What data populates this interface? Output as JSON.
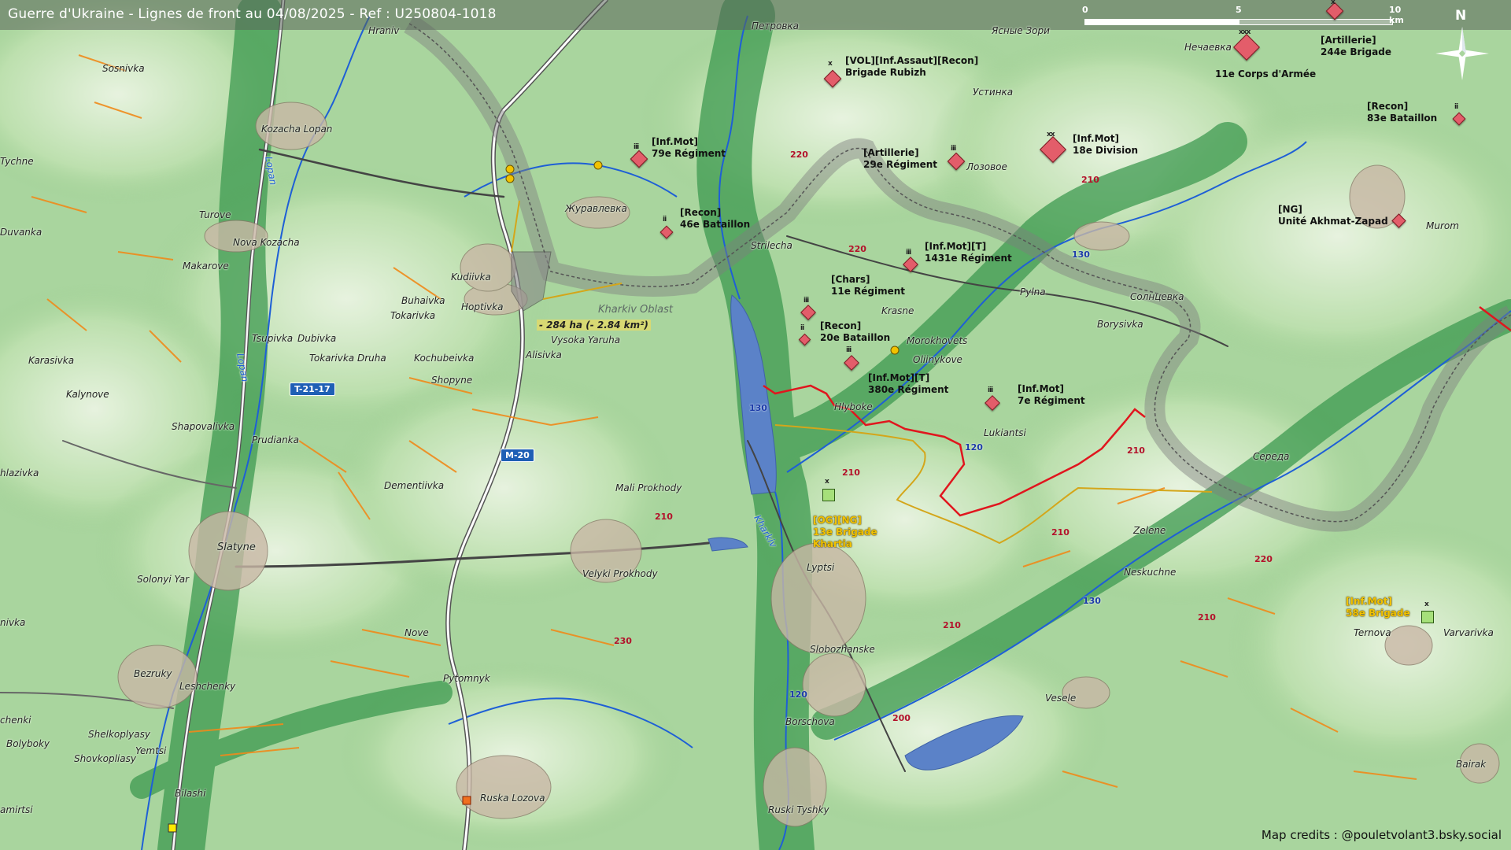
{
  "header": {
    "title": "Guerre d'Ukraine - Lignes de front au 04/08/2025 - Ref : U250804-1018"
  },
  "scale_bar": {
    "ticks": [
      "0",
      "5",
      "10 km"
    ]
  },
  "north_arrow": {
    "letter": "N",
    "icon": "compass-rose-icon"
  },
  "credits": "Map credits : @pouletvolant3.bsky.social",
  "colors": {
    "front_line": "#e0161e",
    "ukraine_line": "#d4a61a",
    "russia_marker": "#e35d6a",
    "ukraine_marker": "#a6e07a",
    "border": "#7a7a7a",
    "water": "#5b82c8"
  },
  "gain": {
    "label": "- 284 ha (- 2.84 km²)"
  },
  "oblast_label": "Kharkiv Oblast",
  "units": [
    {
      "side": "russia",
      "echelon": "x",
      "lines": [
        "[VOL][Inf.Assaut][Recon]",
        "Brigade Rubizh"
      ]
    },
    {
      "side": "russia",
      "echelon": "xx",
      "lines": [
        "[Inf.Mot]",
        "18e Division"
      ]
    },
    {
      "side": "russia",
      "echelon": "xxx",
      "lines": [
        "11e Corps d'Armée"
      ]
    },
    {
      "side": "russia",
      "echelon": "x",
      "lines": [
        "[Artillerie]",
        "244e Brigade"
      ]
    },
    {
      "side": "russia",
      "echelon": "ii",
      "lines": [
        "[Recon]",
        "83e Bataillon"
      ]
    },
    {
      "side": "russia",
      "echelon": "iii",
      "lines": [
        "[Inf.Mot]",
        "79e Régiment"
      ]
    },
    {
      "side": "russia",
      "echelon": "iii",
      "lines": [
        "[Artillerie]",
        "29e Régiment"
      ]
    },
    {
      "side": "russia",
      "echelon": "ii",
      "lines": [
        "[Recon]",
        "46e Bataillon"
      ]
    },
    {
      "side": "russia",
      "echelon": "",
      "lines": [
        "[NG]",
        "Unité Akhmat-Zapad"
      ]
    },
    {
      "side": "russia",
      "echelon": "iii",
      "lines": [
        "[Inf.Mot][T]",
        "1431e Régiment"
      ]
    },
    {
      "side": "russia",
      "echelon": "iii",
      "lines": [
        "[Chars]",
        "11e Régiment"
      ]
    },
    {
      "side": "russia",
      "echelon": "ii",
      "lines": [
        "[Recon]",
        "20e Bataillon"
      ]
    },
    {
      "side": "russia",
      "echelon": "iii",
      "lines": [
        "[Inf.Mot][T]",
        "380e Régiment"
      ]
    },
    {
      "side": "russia",
      "echelon": "iii",
      "lines": [
        "[Inf.Mot]",
        "7e Régiment"
      ]
    },
    {
      "side": "ukraine",
      "echelon": "x",
      "lines": [
        "[OG][NG]",
        "13e Brigade",
        "Khartia"
      ]
    },
    {
      "side": "ukraine",
      "echelon": "x",
      "lines": [
        "[Inf.Mot]",
        "58e Brigade"
      ]
    }
  ],
  "places": [
    "Hraniv",
    "Sosnivka",
    "Kozacha Lopan",
    "Petrovka",
    "Петровка",
    "Ясные Зори",
    "Нечаевка",
    "Устинка",
    "Лозовое",
    "Журавлевка",
    "Turove",
    "Nova Kozacha",
    "Makarove",
    "Kudiivka",
    "Hoptivka",
    "Buhaivka",
    "Tokarivka",
    "Vysoka Yaruha",
    "Alisivka",
    "Tsupivka",
    "Dubivka",
    "Tokarivka Druha",
    "Kochubeivka",
    "Shopyne",
    "Karasivka",
    "Kalynove",
    "Shapovalivka",
    "Prudianka",
    "Dementiivka",
    "Mali Prokhody",
    "Velyki Prokhody",
    "Slatyne",
    "Solonyi Yar",
    "Nove",
    "Pytomnyk",
    "Bezruky",
    "Leshchenky",
    "Shelkoplyasy",
    "Yemtsi",
    "Shovkopliasy",
    "Bolyboky",
    "Bilashi",
    "Ruska Lozova",
    "Strilecha",
    "Krasne",
    "Morokhovets",
    "Oliinykove",
    "Hlyboke",
    "Lukiantsi",
    "Pylna",
    "Солнцевка",
    "Borysivka",
    "Середа",
    "Zelene",
    "Neskuchne",
    "Lyptsi",
    "Slobozhanske",
    "Borschova",
    "Vesele",
    "Ruski Tyshky",
    "Ternova",
    "Varvarivka",
    "Murom",
    "Bairak",
    "Tychne",
    "Duvanka",
    "hlazivka",
    "nivka",
    "chenki",
    "amirtsi"
  ],
  "elevations": [
    "220",
    "210",
    "220",
    "210",
    "210",
    "210",
    "220",
    "210",
    "230",
    "210",
    "200",
    "210"
  ],
  "roads": {
    "shields": [
      "T-21-17",
      "M-20"
    ],
    "numbers": [
      "130",
      "130",
      "120",
      "130",
      "120"
    ]
  },
  "rivers": [
    "Lopan",
    "Lopan",
    "Kharkiv"
  ]
}
